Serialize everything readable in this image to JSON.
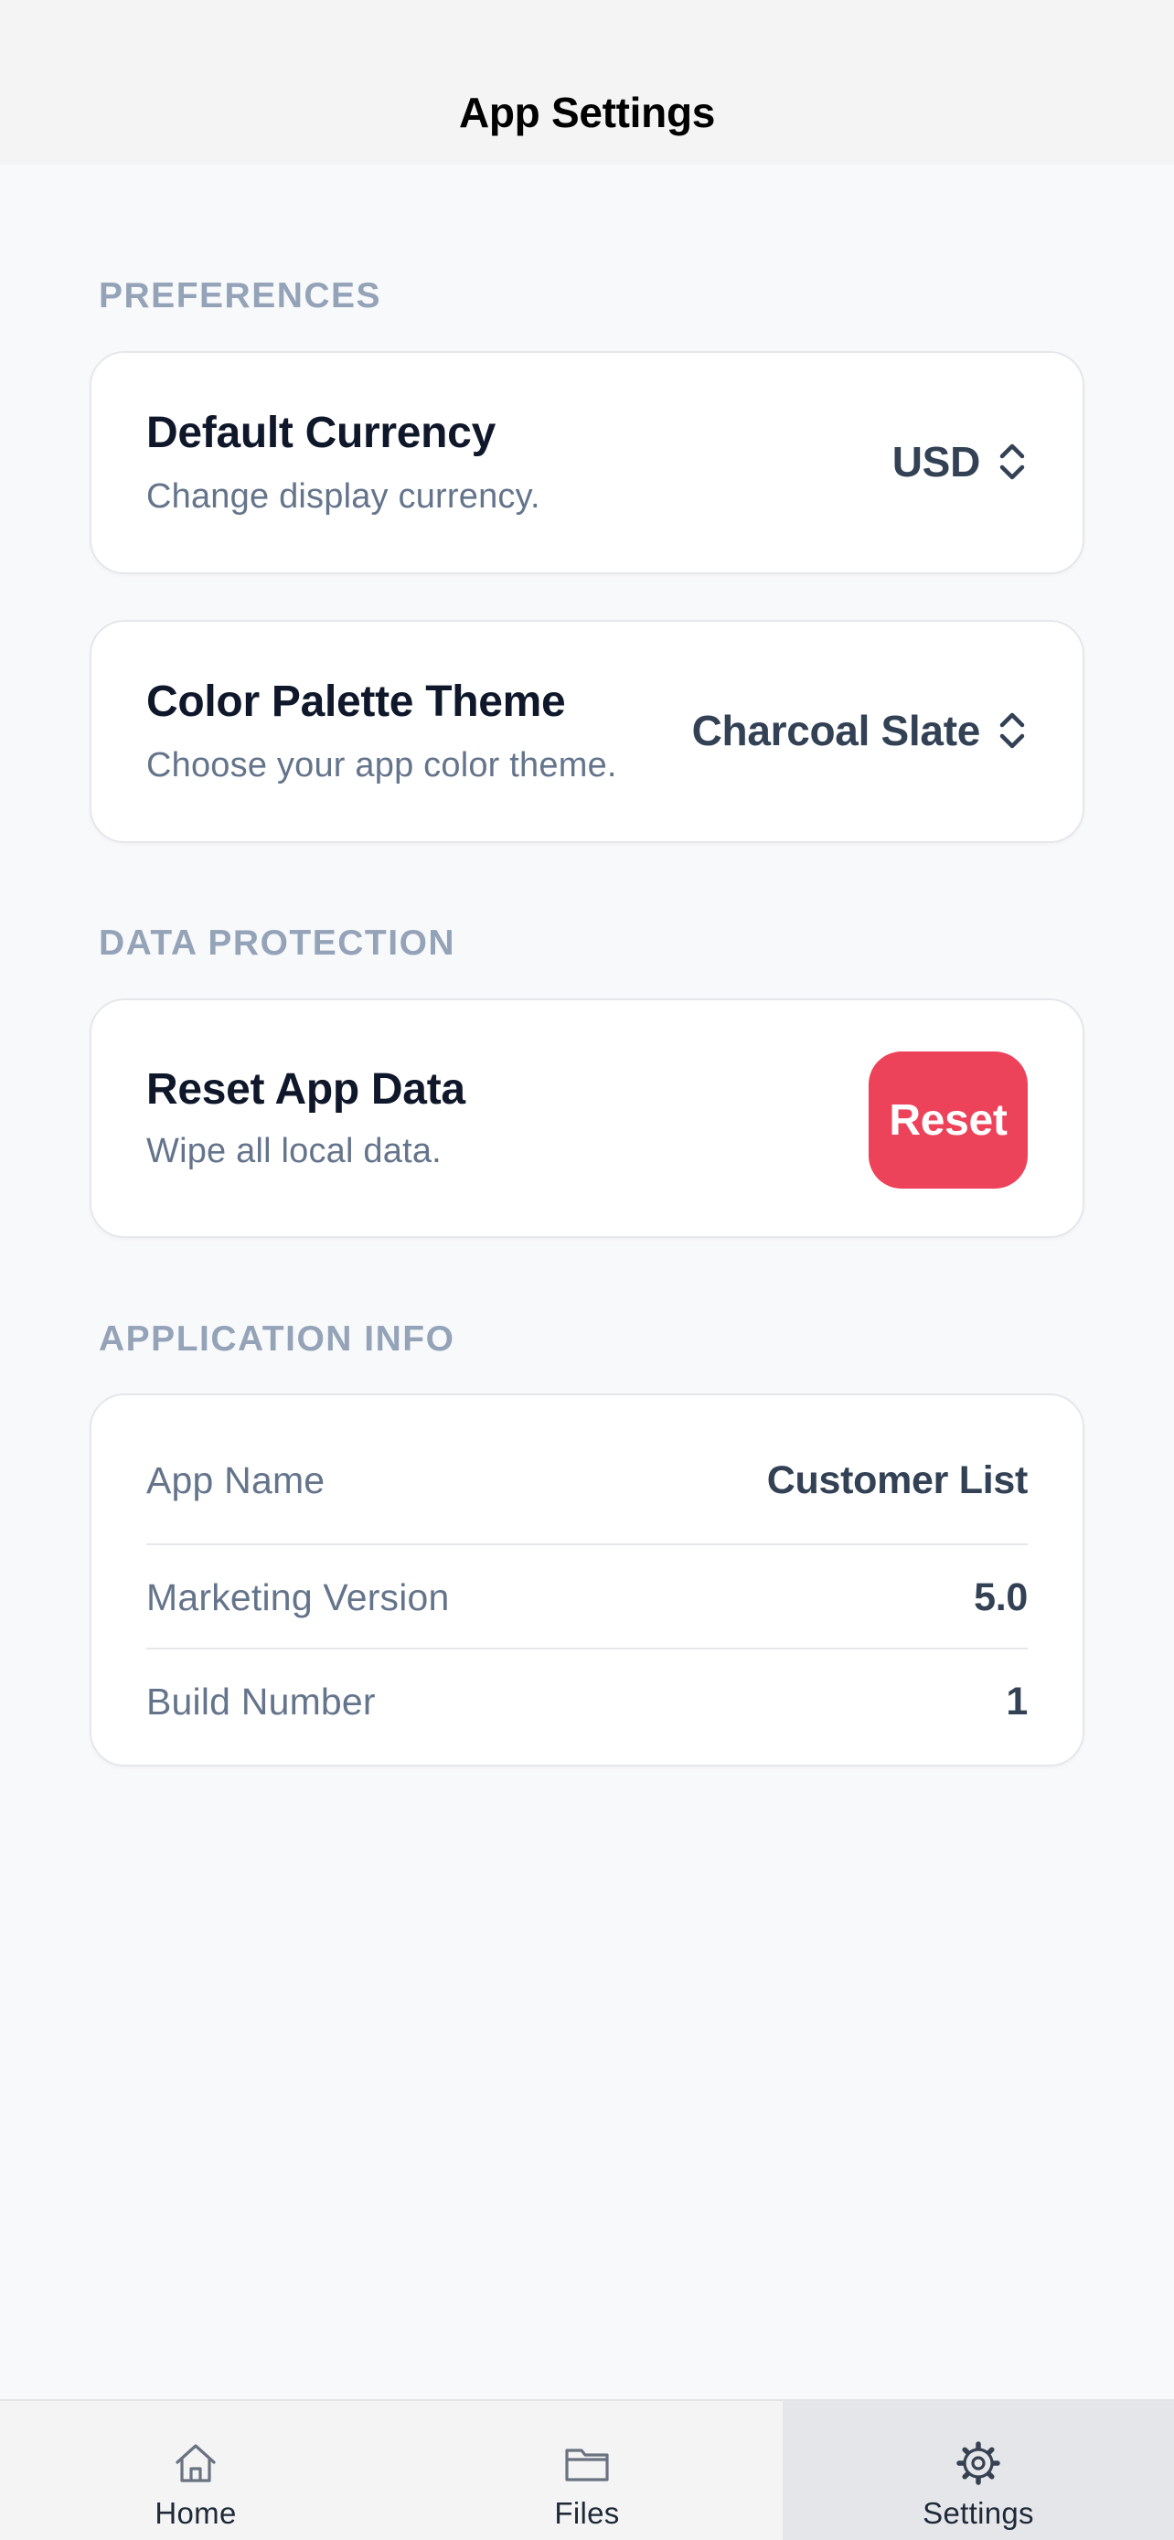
{
  "nav": {
    "title": "App Settings"
  },
  "sections": {
    "preferences": {
      "header": "PREFERENCES",
      "currency": {
        "title": "Default Currency",
        "subtitle": "Change display currency.",
        "value": "USD",
        "icon": "chevron-up-down-icon"
      },
      "theme": {
        "title": "Color Palette Theme",
        "subtitle": "Choose your app color theme.",
        "value": "Charcoal Slate",
        "icon": "chevron-up-down-icon"
      }
    },
    "data_protection": {
      "header": "DATA PROTECTION",
      "reset": {
        "title": "Reset App Data",
        "subtitle": "Wipe all local data.",
        "button_label": "Reset",
        "button_color": "#ec435b"
      }
    },
    "app_info": {
      "header": "APPLICATION INFO",
      "rows": [
        {
          "label": "App Name",
          "value": "Customer List"
        },
        {
          "label": "Marketing Version",
          "value": "5.0"
        },
        {
          "label": "Build Number",
          "value": "1"
        }
      ]
    }
  },
  "tab_bar": {
    "tabs": [
      {
        "label": "Home",
        "icon": "home-icon",
        "active": false
      },
      {
        "label": "Files",
        "icon": "folder-icon",
        "active": false
      },
      {
        "label": "Settings",
        "icon": "gear-icon",
        "active": true
      }
    ]
  },
  "colors": {
    "accent_danger": "#ec435b",
    "section_header": "#94a3b8",
    "background": "#f8f9fb"
  }
}
